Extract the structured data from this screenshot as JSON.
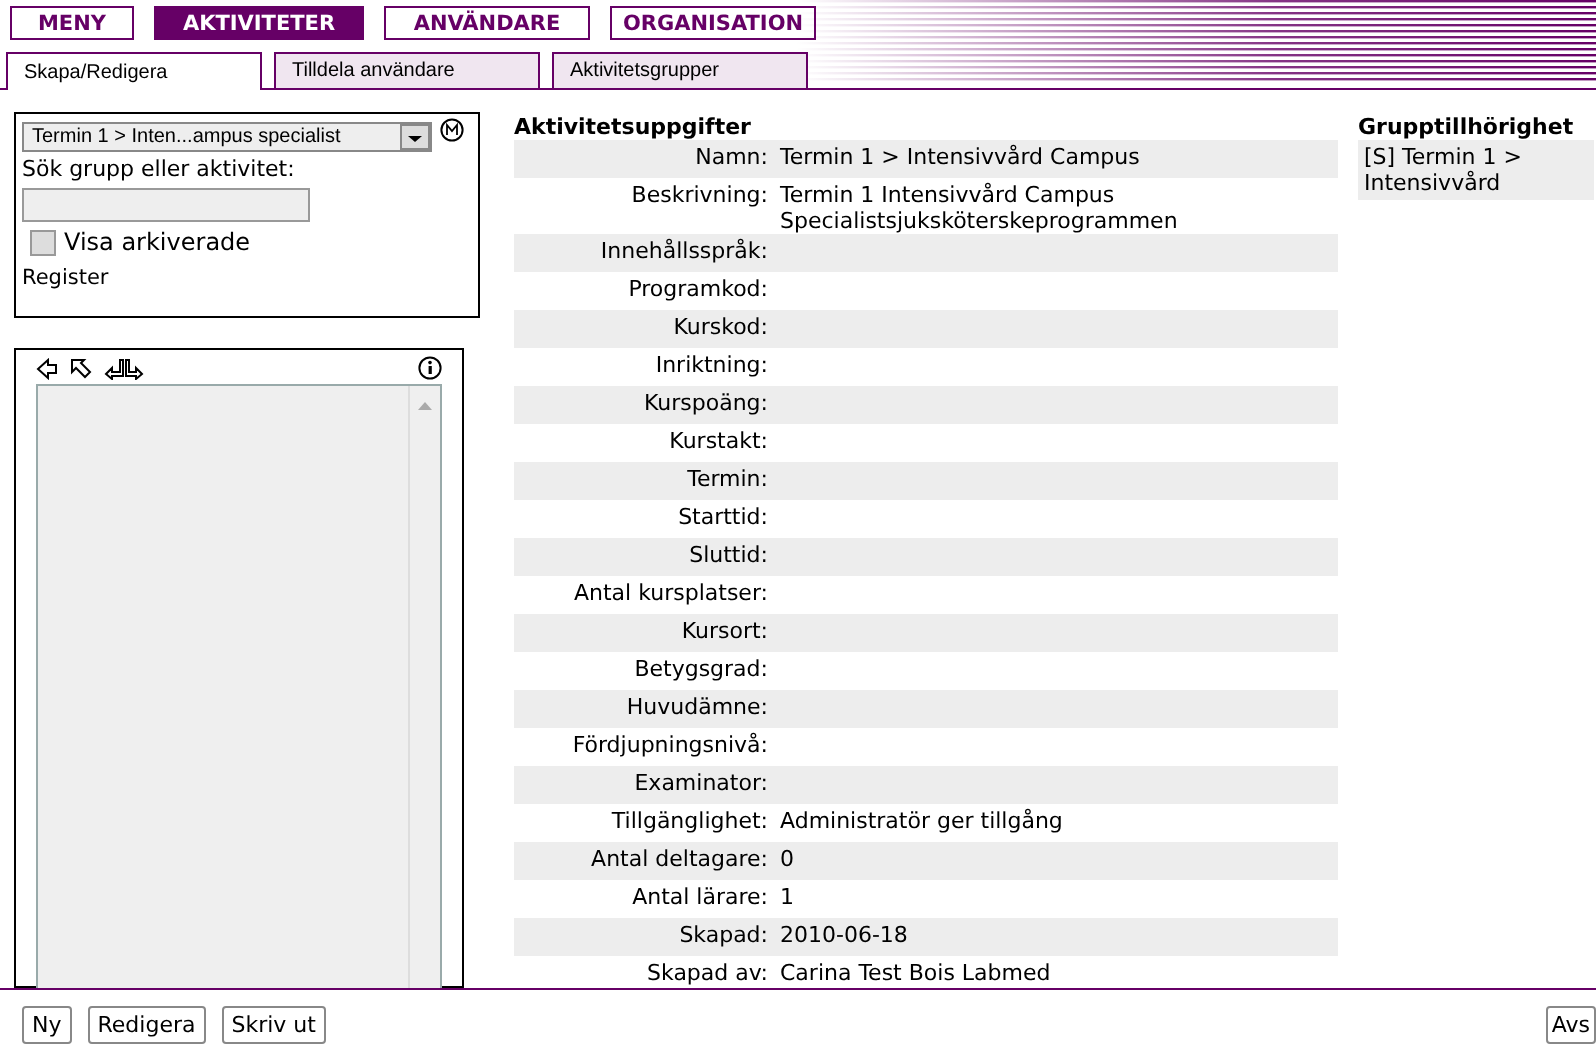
{
  "nav": [
    {
      "label": "MENY",
      "selected": false
    },
    {
      "label": "AKTIVITETER",
      "selected": true
    },
    {
      "label": "ANVÄNDARE",
      "selected": false
    },
    {
      "label": "ORGANISATION",
      "selected": false
    }
  ],
  "tabs": [
    {
      "label": "Skapa/Redigera",
      "selected": true
    },
    {
      "label": "Tilldela användare",
      "selected": false
    },
    {
      "label": "Aktivitetsgrupper",
      "selected": false
    }
  ],
  "search_panel": {
    "dropdown": "Termin 1 > Inten...ampus specialist",
    "search_label": "Sök grupp eller aktivitet:",
    "show_archived": {
      "label": "Visa arkiverade",
      "checked": false
    },
    "register_link": "Register"
  },
  "details": {
    "title": "Aktivitetsuppgifter",
    "fields": [
      {
        "label": "Namn:",
        "value": "Termin 1 > Intensivvård Campus"
      },
      {
        "label": "Beskrivning:",
        "value": "Termin 1 Intensivvård Campus Specialistsjuksköterskeprogrammen"
      },
      {
        "label": "Innehållsspråk:"
      },
      {
        "label": "Programkod:"
      },
      {
        "label": "Kurskod:"
      },
      {
        "label": "Inriktning:"
      },
      {
        "label": "Kurspoäng:"
      },
      {
        "label": "Kurstakt:"
      },
      {
        "label": "Termin:"
      },
      {
        "label": "Starttid:"
      },
      {
        "label": "Sluttid:"
      },
      {
        "label": "Antal kursplatser:"
      },
      {
        "label": "Kursort:"
      },
      {
        "label": "Betygsgrad:"
      },
      {
        "label": "Huvudämne:"
      },
      {
        "label": "Fördjupningsnivå:"
      },
      {
        "label": "Examinator:"
      },
      {
        "label": "Tillgänglighet:",
        "value": "Administratör ger tillgång"
      },
      {
        "label": "Antal deltagare:",
        "value": "0"
      },
      {
        "label": "Antal lärare:",
        "value": "1"
      },
      {
        "label": "Skapad:",
        "value": "2010-06-18"
      },
      {
        "label": "Skapad av:",
        "value": "Carina Test Bois Labmed"
      }
    ]
  },
  "group_membership": {
    "title": "Grupptillhörighet",
    "items": [
      "[S] Termin 1 > Intensivvård"
    ]
  },
  "buttons": [
    "Ny",
    "Redigera",
    "Skriv ut"
  ],
  "right_button": "Avs"
}
